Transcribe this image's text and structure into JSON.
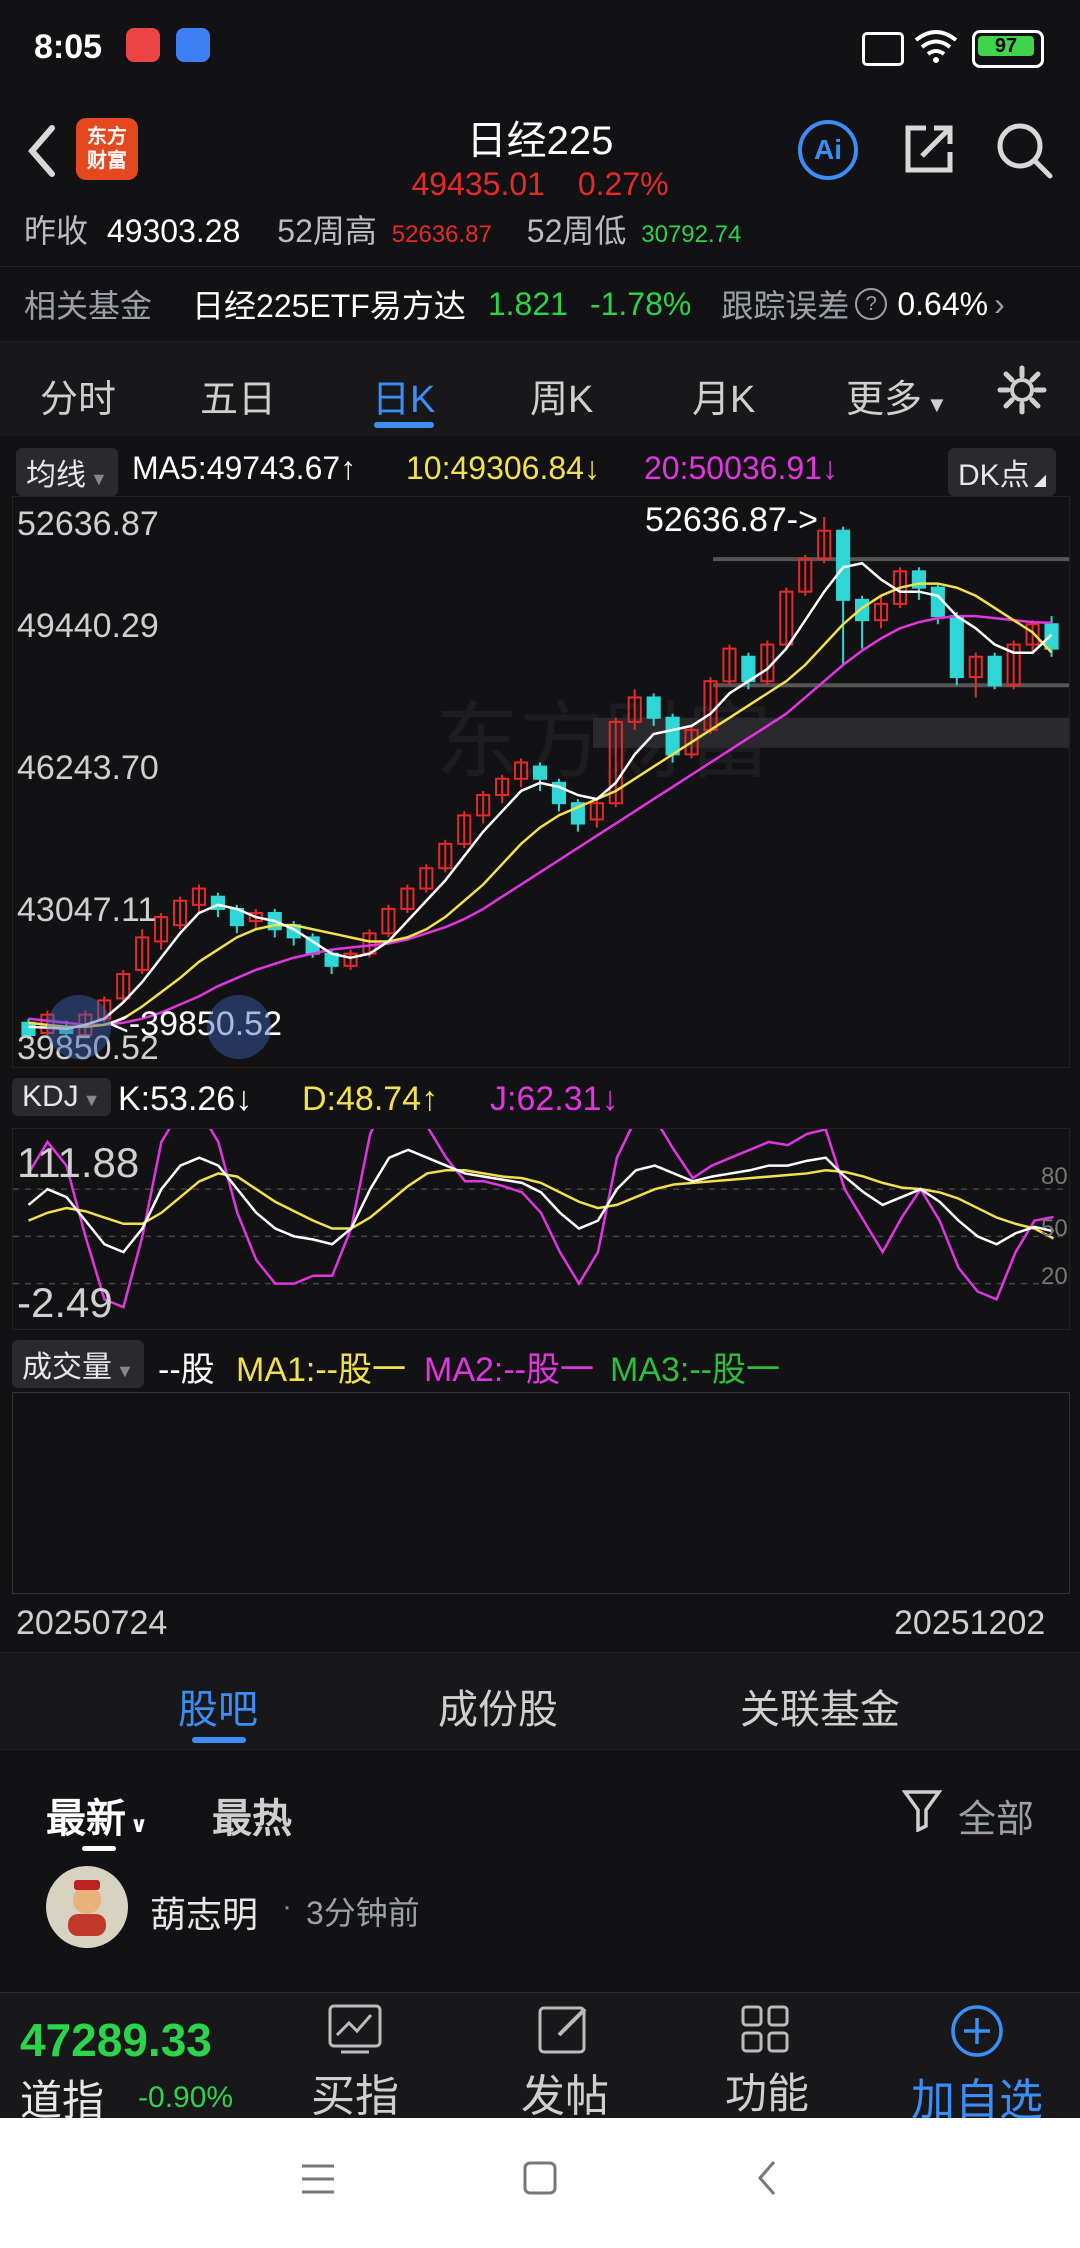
{
  "status_bar": {
    "time": "8:05",
    "battery": "97"
  },
  "header": {
    "title": "日经225",
    "price": "49435.01",
    "change": "0.27%",
    "logo_text": "东方\n财富",
    "ai_label": "Ai"
  },
  "strip1": {
    "prev_close_label": "昨收",
    "prev_close_value": "49303.28",
    "high52_label": "52周高",
    "high52_value": "52636.87",
    "low52_label": "52周低",
    "low52_value": "30792.74"
  },
  "related_fund": {
    "label": "相关基金",
    "name": "日经225ETF易方达",
    "price": "1.821",
    "change": "-1.78%",
    "track_label": "跟踪误差",
    "track_value": "0.64%"
  },
  "tabs": [
    {
      "label": "分时"
    },
    {
      "label": "五日"
    },
    {
      "label": "日K"
    },
    {
      "label": "周K"
    },
    {
      "label": "月K"
    },
    {
      "label": "更多"
    }
  ],
  "ma": {
    "pill": "均线",
    "ma5": "MA5:49743.67",
    "ma10": "10:49306.84",
    "ma20": "20:50036.91",
    "dk": "DK点"
  },
  "price_axis": [
    "52636.87",
    "49440.29",
    "46243.70",
    "43047.11",
    "39850.52"
  ],
  "annotations": {
    "high": "52636.87->",
    "low": "<-39850.52"
  },
  "kdj": {
    "pill": "KDJ",
    "k": "K:53.26",
    "d": "D:48.74",
    "j": "J:62.31",
    "top": "111.88",
    "bottom": "-2.49",
    "r80": "80",
    "r50": "50",
    "r20": "20"
  },
  "volume": {
    "pill": "成交量",
    "val": "--股",
    "ma1": "MA1:--股一",
    "ma2": "MA2:--股一",
    "ma3": "MA3:--股一"
  },
  "dates": {
    "start": "20250724",
    "end": "20251202"
  },
  "subnav": [
    {
      "label": "股吧"
    },
    {
      "label": "成份股"
    },
    {
      "label": "关联基金"
    }
  ],
  "sorts": {
    "latest": "最新",
    "hot": "最热",
    "filter": "全部"
  },
  "post": {
    "author": "葫志明",
    "dot": "·",
    "time": "3分钟前"
  },
  "bottom": {
    "index_price": "47289.33",
    "index_name": "道指",
    "index_change": "-0.90%",
    "buy": "买指数",
    "post": "发帖",
    "func": "功能",
    "add": "加自选"
  },
  "colors": {
    "accent": "#3a8ef6",
    "up": "#e52a2a",
    "down": "#2bd44b",
    "ma5": "#ffffff",
    "ma10": "#f2e14b",
    "ma20": "#e235e2"
  },
  "chart_data": {
    "type": "candlestick",
    "ylim": [
      39850.52,
      52636.87
    ],
    "candles": [
      [
        40200,
        39900,
        40300,
        39800
      ],
      [
        39950,
        40400,
        40500,
        39900
      ],
      [
        40100,
        39950,
        40250,
        39850
      ],
      [
        39900,
        40400,
        40500,
        39850
      ],
      [
        40300,
        40750,
        40850,
        40200
      ],
      [
        40800,
        41400,
        41500,
        40700
      ],
      [
        41500,
        42300,
        42500,
        41400
      ],
      [
        42200,
        42800,
        42900,
        42000
      ],
      [
        42600,
        43200,
        43300,
        42500
      ],
      [
        43100,
        43500,
        43600,
        42900
      ],
      [
        43300,
        43000,
        43400,
        42800
      ],
      [
        43000,
        42600,
        43100,
        42400
      ],
      [
        42700,
        42900,
        43000,
        42500
      ],
      [
        42900,
        42500,
        43000,
        42300
      ],
      [
        42600,
        42300,
        42700,
        42100
      ],
      [
        42300,
        41900,
        42400,
        41800
      ],
      [
        41900,
        41600,
        42000,
        41400
      ],
      [
        41600,
        41900,
        42000,
        41500
      ],
      [
        41900,
        42400,
        42500,
        41800
      ],
      [
        42400,
        43000,
        43100,
        42300
      ],
      [
        43000,
        43500,
        43600,
        42900
      ],
      [
        43500,
        44000,
        44100,
        43400
      ],
      [
        44000,
        44600,
        44700,
        43900
      ],
      [
        44600,
        45300,
        45400,
        44500
      ],
      [
        45300,
        45800,
        45900,
        45100
      ],
      [
        45800,
        46200,
        46300,
        45600
      ],
      [
        46200,
        46600,
        46700,
        46000
      ],
      [
        46500,
        46200,
        46600,
        45900
      ],
      [
        46100,
        45600,
        46200,
        45400
      ],
      [
        45600,
        45100,
        45700,
        44900
      ],
      [
        45200,
        45600,
        45700,
        45000
      ],
      [
        45600,
        47600,
        47700,
        45500
      ],
      [
        47600,
        48200,
        48400,
        47400
      ],
      [
        48200,
        47700,
        48300,
        47500
      ],
      [
        47700,
        46800,
        47800,
        46600
      ],
      [
        46800,
        47400,
        47500,
        46700
      ],
      [
        47400,
        48600,
        48700,
        47300
      ],
      [
        48600,
        49400,
        49500,
        48500
      ],
      [
        49200,
        48600,
        49300,
        48400
      ],
      [
        48600,
        49500,
        49600,
        48500
      ],
      [
        49500,
        50800,
        50900,
        49400
      ],
      [
        50800,
        51600,
        51700,
        50700
      ],
      [
        51600,
        52300,
        52636.87,
        51500
      ],
      [
        52300,
        50600,
        52400,
        49000
      ],
      [
        50600,
        50100,
        50700,
        49400
      ],
      [
        50100,
        50500,
        50700,
        49900
      ],
      [
        50500,
        51300,
        51400,
        50400
      ],
      [
        51300,
        50900,
        51400,
        50600
      ],
      [
        50900,
        50200,
        51000,
        50000
      ],
      [
        50200,
        48700,
        50300,
        48500
      ],
      [
        48700,
        49200,
        49300,
        48200
      ],
      [
        49200,
        48500,
        49300,
        48400
      ],
      [
        48500,
        49500,
        49600,
        48400
      ],
      [
        49500,
        50000,
        50100,
        49300
      ],
      [
        50000,
        49400,
        50200,
        49200
      ]
    ],
    "ma5": [
      40100,
      40080,
      40050,
      40150,
      40300,
      40700,
      41200,
      41800,
      42400,
      42900,
      43100,
      43000,
      42800,
      42700,
      42500,
      42200,
      41900,
      41800,
      41900,
      42200,
      42700,
      43200,
      43700,
      44300,
      44900,
      45400,
      45900,
      46100,
      46000,
      45800,
      45700,
      46100,
      46800,
      47300,
      47400,
      47500,
      47800,
      48300,
      48600,
      48900,
      49400,
      50100,
      50800,
      51400,
      51500,
      51100,
      50800,
      50800,
      50700,
      50200,
      49900,
      49500,
      49300,
      49300,
      49743.67
    ],
    "ma10": [
      40200,
      40150,
      40100,
      40100,
      40150,
      40300,
      40600,
      40950,
      41300,
      41700,
      42000,
      42300,
      42500,
      42600,
      42600,
      42500,
      42400,
      42300,
      42200,
      42200,
      42300,
      42500,
      42800,
      43200,
      43600,
      44100,
      44600,
      45000,
      45300,
      45500,
      45700,
      45900,
      46200,
      46500,
      46800,
      47100,
      47400,
      47700,
      48000,
      48300,
      48600,
      49000,
      49500,
      50000,
      50400,
      50700,
      50900,
      51000,
      51000,
      50900,
      50700,
      50400,
      50100,
      49800,
      49306.84
    ],
    "ma20": [
      40300,
      40250,
      40200,
      40150,
      40150,
      40200,
      40300,
      40450,
      40650,
      40850,
      41100,
      41300,
      41500,
      41650,
      41800,
      41900,
      42000,
      42050,
      42100,
      42150,
      42250,
      42400,
      42550,
      42750,
      43000,
      43300,
      43600,
      43900,
      44200,
      44500,
      44800,
      45100,
      45400,
      45700,
      46000,
      46300,
      46600,
      46900,
      47200,
      47500,
      47800,
      48200,
      48600,
      49000,
      49350,
      49650,
      49900,
      50050,
      50150,
      50200,
      50200,
      50150,
      50100,
      50050,
      50036.91
    ],
    "kdj_k": [
      70,
      80,
      75,
      60,
      45,
      40,
      55,
      80,
      95,
      100,
      95,
      80,
      65,
      55,
      50,
      48,
      45,
      55,
      80,
      100,
      105,
      100,
      95,
      90,
      88,
      86,
      84,
      78,
      65,
      55,
      60,
      80,
      92,
      95,
      90,
      85,
      88,
      90,
      92,
      95,
      95,
      98,
      100,
      88,
      78,
      70,
      75,
      80,
      72,
      60,
      50,
      45,
      52,
      56,
      53.26
    ],
    "kdj_d": [
      60,
      65,
      68,
      66,
      62,
      58,
      58,
      65,
      75,
      85,
      90,
      88,
      80,
      72,
      66,
      60,
      55,
      55,
      62,
      72,
      82,
      90,
      92,
      92,
      90,
      88,
      87,
      84,
      78,
      72,
      68,
      70,
      75,
      80,
      83,
      84,
      85,
      86,
      87,
      88,
      89,
      90,
      92,
      91,
      88,
      84,
      81,
      80,
      78,
      74,
      68,
      62,
      58,
      55,
      48.74
    ],
    "kdj_j": [
      90,
      110,
      95,
      50,
      10,
      5,
      50,
      110,
      130,
      130,
      110,
      65,
      35,
      20,
      20,
      25,
      25,
      55,
      115,
      140,
      150,
      120,
      100,
      85,
      85,
      82,
      78,
      65,
      40,
      20,
      40,
      100,
      125,
      125,
      105,
      87,
      95,
      100,
      105,
      110,
      108,
      115,
      118,
      80,
      60,
      40,
      62,
      80,
      60,
      30,
      15,
      10,
      40,
      60,
      62.31
    ]
  }
}
